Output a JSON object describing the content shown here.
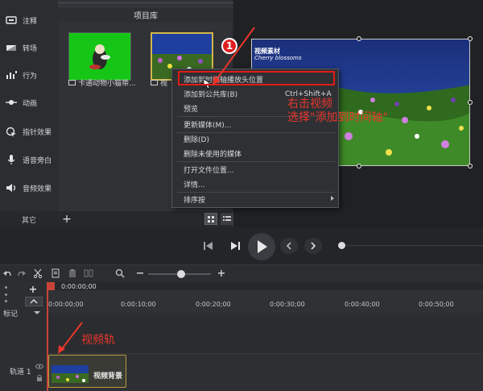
{
  "sidebar": {
    "items": [
      {
        "label": "注释",
        "icon": "annotation-icon"
      },
      {
        "label": "转场",
        "icon": "transition-icon"
      },
      {
        "label": "行为",
        "icon": "behavior-icon"
      },
      {
        "label": "动画",
        "icon": "animation-icon"
      },
      {
        "label": "指针效果",
        "icon": "cursor-effect-icon"
      },
      {
        "label": "语音旁白",
        "icon": "microphone-icon"
      },
      {
        "label": "音频效果",
        "icon": "audio-effect-icon"
      }
    ],
    "footer_label": "其它",
    "add_label": "+"
  },
  "media_bin": {
    "title": "项目库",
    "items": [
      {
        "label": "卡通动物小猫带..."
      },
      {
        "label": "视"
      }
    ]
  },
  "preview": {
    "overlay_title": "视频素材",
    "overlay_subtitle": "Cherry blossoms"
  },
  "context_menu": {
    "items": [
      {
        "label": "添加到时间轴播放头位置",
        "shortcut": ""
      },
      {
        "label": "添加到公共库(B)",
        "shortcut": "Ctrl+Shift+A"
      },
      {
        "label": "预览",
        "shortcut": ""
      },
      {
        "label": "更新媒体(M)...",
        "shortcut": ""
      },
      {
        "label": "删除(D)",
        "shortcut": ""
      },
      {
        "label": "删除未使用的媒体",
        "shortcut": ""
      },
      {
        "label": "打开文件位置...",
        "shortcut": ""
      },
      {
        "label": "详情...",
        "shortcut": ""
      },
      {
        "label": "排序按",
        "shortcut": ""
      }
    ]
  },
  "annotations": {
    "badge": "1",
    "instruction_line1": "右击视频",
    "instruction_line2": "选择\"添加到时间轴\"",
    "video_track_label": "视频轨"
  },
  "timeline": {
    "playhead_time": "0:00:00;00",
    "ticks": [
      "0:00:00;00",
      "0:00:10;00",
      "0:00:20;00",
      "0:00:30;00",
      "0:00:40;00",
      "0:00:50;00"
    ],
    "marker_label": "标记",
    "track_label": "轨道 1",
    "clip_label": "视频背景"
  },
  "colors": {
    "accent_red": "#e11b16",
    "clip_border": "#b99a3a",
    "playhead": "#c8443a"
  }
}
